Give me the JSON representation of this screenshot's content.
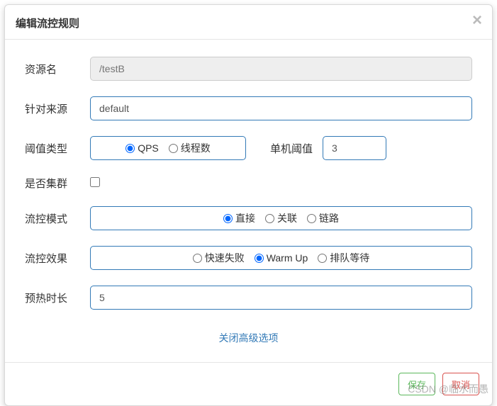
{
  "header": {
    "title": "编辑流控规则"
  },
  "form": {
    "resource": {
      "label": "资源名",
      "value": "/testB"
    },
    "source": {
      "label": "针对来源",
      "value": "default"
    },
    "thresholdType": {
      "label": "阈值类型",
      "options": {
        "qps": "QPS",
        "threads": "线程数"
      }
    },
    "thresholdValue": {
      "label": "单机阈值",
      "value": "3"
    },
    "cluster": {
      "label": "是否集群"
    },
    "mode": {
      "label": "流控模式",
      "options": {
        "direct": "直接",
        "relate": "关联",
        "chain": "链路"
      }
    },
    "effect": {
      "label": "流控效果",
      "options": {
        "fail": "快速失败",
        "warmup": "Warm Up",
        "queue": "排队等待"
      }
    },
    "warmup": {
      "label": "预热时长",
      "value": "5"
    },
    "advanced": "关闭高级选项"
  },
  "footer": {
    "save": "保存",
    "cancel": "取消"
  },
  "watermark": "CSDN @临水而愚"
}
